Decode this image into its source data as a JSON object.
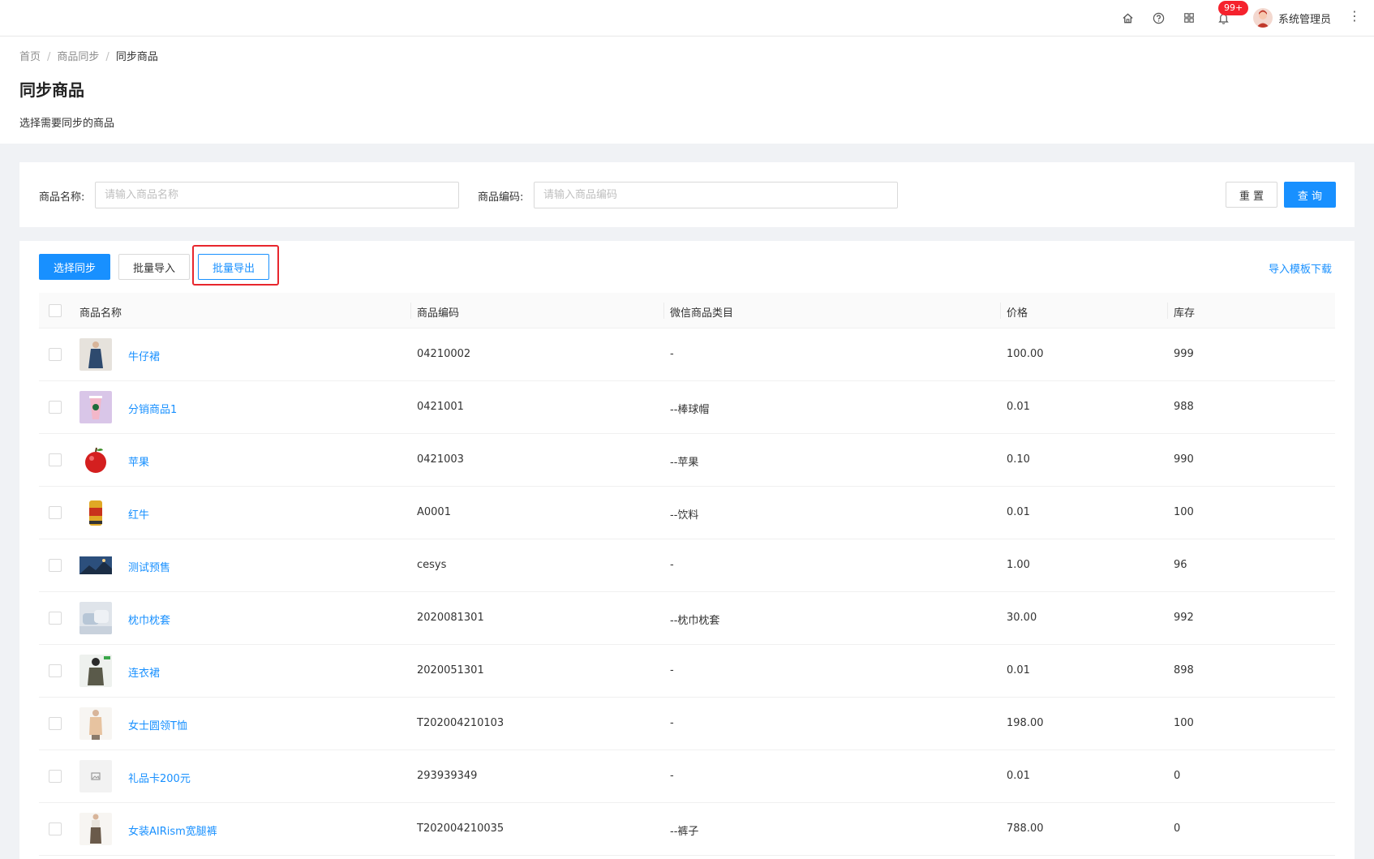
{
  "topbar": {
    "icons": [
      "home-icon",
      "question-icon",
      "apps-icon",
      "bell-icon"
    ],
    "badge": "99+",
    "username": "系统管理员",
    "more": "⋮"
  },
  "breadcrumb": {
    "items": [
      "首页",
      "商品同步",
      "同步商品"
    ],
    "separator": "/"
  },
  "page": {
    "title": "同步商品",
    "description": "选择需要同步的商品"
  },
  "search": {
    "name_label": "商品名称:",
    "name_placeholder": "请输入商品名称",
    "name_value": "",
    "code_label": "商品编码:",
    "code_placeholder": "请输入商品编码",
    "code_value": "",
    "reset_label": "重 置",
    "query_label": "查 询"
  },
  "toolbar": {
    "select_sync": "选择同步",
    "batch_import": "批量导入",
    "batch_export": "批量导出",
    "template_download": "导入模板下载"
  },
  "table": {
    "columns": [
      "商品名称",
      "商品编码",
      "微信商品类目",
      "价格",
      "库存"
    ],
    "rows": [
      {
        "name": "牛仔裙",
        "code": "04210002",
        "category": "-",
        "price": "100.00",
        "stock": "999",
        "thumb": "dress-photo"
      },
      {
        "name": "分销商品1",
        "code": "0421001",
        "category": "--棒球帽",
        "price": "0.01",
        "stock": "988",
        "thumb": "drink-photo"
      },
      {
        "name": "苹果",
        "code": "0421003",
        "category": "--苹果",
        "price": "0.10",
        "stock": "990",
        "thumb": "apple-photo"
      },
      {
        "name": "红牛",
        "code": "A0001",
        "category": "--饮料",
        "price": "0.01",
        "stock": "100",
        "thumb": "can-photo"
      },
      {
        "name": "测试预售",
        "code": "cesys",
        "category": "-",
        "price": "1.00",
        "stock": "96",
        "thumb": "landscape-photo"
      },
      {
        "name": "枕巾枕套",
        "code": "2020081301",
        "category": "--枕巾枕套",
        "price": "30.00",
        "stock": "992",
        "thumb": "pillow-photo"
      },
      {
        "name": "连衣裙",
        "code": "2020051301",
        "category": "-",
        "price": "0.01",
        "stock": "898",
        "thumb": "model-photo"
      },
      {
        "name": "女士圆领T恤",
        "code": "T202004210103",
        "category": "-",
        "price": "198.00",
        "stock": "100",
        "thumb": "tshirt-photo"
      },
      {
        "name": "礼品卡200元",
        "code": "293939349",
        "category": "-",
        "price": "0.01",
        "stock": "0",
        "thumb": "image-placeholder-icon"
      },
      {
        "name": "女装AIRism宽腿裤",
        "code": "T202004210035",
        "category": "--裤子",
        "price": "788.00",
        "stock": "0",
        "thumb": "pants-photo"
      }
    ]
  },
  "colors": {
    "primary": "#1890ff",
    "highlight": "#e8262d",
    "badge": "#f5222d"
  }
}
